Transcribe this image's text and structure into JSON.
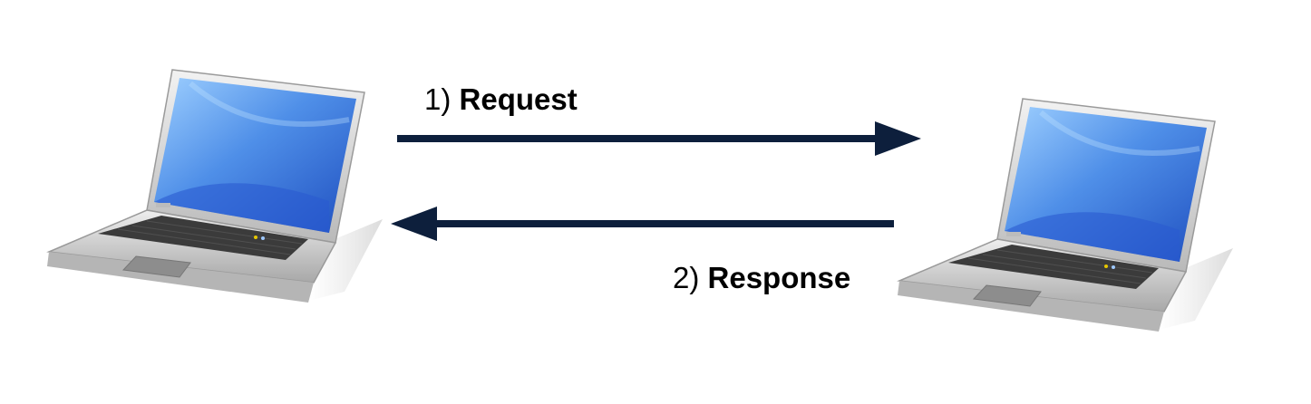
{
  "diagram": {
    "request": {
      "step": "1)",
      "text": "Request"
    },
    "response": {
      "step": "2)",
      "text": "Response"
    }
  },
  "colors": {
    "arrow": "#0d1f3c",
    "screen": "#3d7be0",
    "body": "#d9d9d9"
  },
  "icons": {
    "left": "laptop-icon",
    "right": "laptop-icon"
  }
}
